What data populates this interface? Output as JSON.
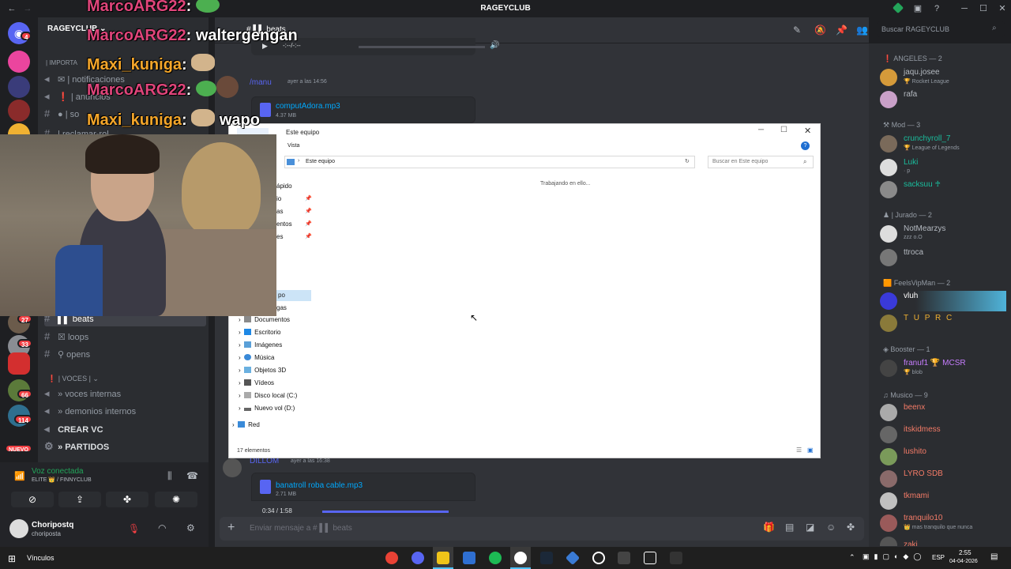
{
  "window": {
    "title": "RAGEYCLUB"
  },
  "server": {
    "name": "RAGEYCLUB",
    "search_placeholder": "Buscar RAGEYCLUB"
  },
  "badges": {
    "discord": "4",
    "b27": "27",
    "b33": "33",
    "b66": "66",
    "b114": "114",
    "nuevo": "NUEVO"
  },
  "channels": {
    "importante": "| IMPORTA",
    "notificaciones": "| notificaciones",
    "anuncios": "| anuncios",
    "soporte": "| so",
    "reclamar": "| reclamar-rol",
    "beats": "beats",
    "loops": "loops",
    "opens": "opens",
    "voces_cat": "| VOCES |",
    "voces_internas": "» voces internas",
    "demonios": "» demonios internos",
    "crear_vc": "CREAR VC",
    "partidos": "» PARTIDOS"
  },
  "voice": {
    "status": "Voz conectada",
    "server": "ELITE 👑 / FINNYCLUB"
  },
  "user": {
    "name": "Choripostq",
    "tag": "choriposta"
  },
  "chat_header": {
    "channel": "beats"
  },
  "messages": [
    {
      "author": "/manu",
      "time": "ayer a las 14:56",
      "file": "computAdora.mp3",
      "size": "4.37 MB"
    },
    {
      "author": "DILLOM",
      "time": "ayer a las 16:38",
      "file": "banatroll roba cable.mp3",
      "size": "2.71 MB"
    }
  ],
  "audio": {
    "time_top": "-:--/-:--",
    "time_bottom": "0:34 / 1:58"
  },
  "composer": {
    "placeholder": "Enviar mensaje a #",
    "channel": "beats"
  },
  "overlay_chat": [
    {
      "user": "MarcoARG22",
      "text": "",
      "color": "#e0457b"
    },
    {
      "user": "MarcoARG22",
      "text": "waltergengan",
      "color": "#e0457b"
    },
    {
      "user": "Maxi_kuniga",
      "text": "",
      "color": "#f4a62a"
    },
    {
      "user": "MarcoARG22",
      "text": "",
      "color": "#e0457b"
    },
    {
      "user": "Maxi_kuniga",
      "text": "wapo",
      "color": "#f4a62a"
    }
  ],
  "explorer": {
    "title": "Este equipo",
    "menu": "Vista",
    "address": "Este equipo",
    "search_placeholder": "Buscar en Este equipo",
    "status_working": "Trabajando en ello...",
    "quick_access": "ápido",
    "qa_items": [
      "io",
      "as",
      "entos",
      "es"
    ],
    "sel": "po",
    "sel2": "gas",
    "tree": [
      "Documentos",
      "Escritorio",
      "Imágenes",
      "Música",
      "Objetos 3D",
      "Vídeos",
      "Disco local (C:)",
      "Nuevo vol (D:)",
      "Red"
    ],
    "count": "17 elementos"
  },
  "members": {
    "groups": [
      {
        "label": "ANGELES — 2"
      },
      {
        "label": "Mod — 3"
      },
      {
        "label": "| Jurado — 2"
      },
      {
        "label": "FeelsVipMan — 2"
      },
      {
        "label": "Booster — 1"
      },
      {
        "label": "Musico — 9"
      }
    ],
    "list": [
      {
        "name": "jaqu.josee",
        "sub": "🏆 Rocket League",
        "color": "#b5bac1"
      },
      {
        "name": "rafa",
        "sub": "",
        "color": "#b5bac1"
      },
      {
        "name": "crunchyroll_7",
        "sub": "🏆 League of Legends",
        "color": "#1abc9c"
      },
      {
        "name": "Luki",
        "sub": "· p",
        "color": "#1abc9c"
      },
      {
        "name": "sacksuu ♰",
        "sub": "",
        "color": "#1abc9c"
      },
      {
        "name": "NotMearzys",
        "sub": "zzz o.O",
        "color": "#b5bac1"
      },
      {
        "name": "ttroca",
        "sub": "",
        "color": "#b5bac1"
      },
      {
        "name": "vluh",
        "sub": "",
        "color": "#ffffff"
      },
      {
        "name": "T U P R C",
        "sub": "",
        "color": "#f0b132"
      },
      {
        "name": "franuf1 🏆 MCSR",
        "sub": "🏆 blob",
        "color": "#c77dff"
      },
      {
        "name": "beenx",
        "sub": "",
        "color": "#f47b67"
      },
      {
        "name": "itskidmess",
        "sub": "",
        "color": "#f47b67"
      },
      {
        "name": "lushito",
        "sub": "",
        "color": "#f47b67"
      },
      {
        "name": "LYRO SDB",
        "sub": "",
        "color": "#f47b67"
      },
      {
        "name": "tkmami",
        "sub": "",
        "color": "#f47b67"
      },
      {
        "name": "tranquilo10",
        "sub": "👑 mas tranquilo que nunca",
        "color": "#f47b67"
      },
      {
        "name": "zaki",
        "sub": "",
        "color": "#f47b67"
      }
    ]
  },
  "taskbar": {
    "start_label": "Vínculos",
    "lang": "ESP",
    "time": "2:55",
    "date": "04-04-2026"
  }
}
